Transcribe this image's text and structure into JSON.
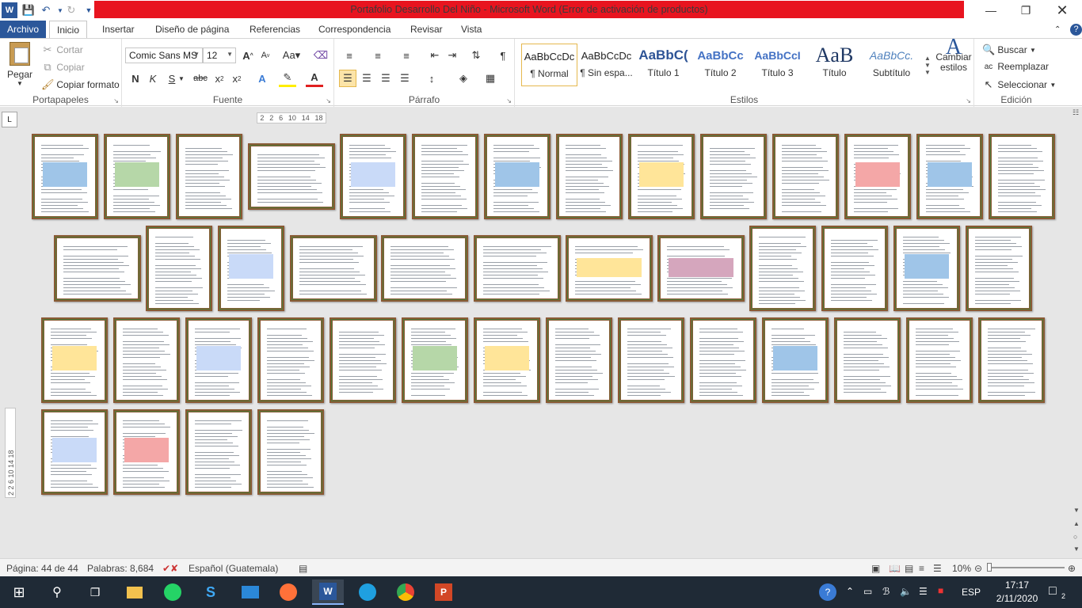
{
  "window": {
    "title": "Portafolio Desarrollo Del Niño  -  Microsoft Word (Error de activación de productos)",
    "controls": [
      "minimize",
      "restore",
      "close"
    ]
  },
  "tabs": [
    "Archivo",
    "Inicio",
    "Insertar",
    "Diseño de página",
    "Referencias",
    "Correspondencia",
    "Revisar",
    "Vista"
  ],
  "ribbon": {
    "clipboard": {
      "label": "Portapapeles",
      "paste": "Pegar",
      "cut": "Cortar",
      "copy": "Copiar",
      "format_painter": "Copiar formato"
    },
    "font": {
      "label": "Fuente",
      "family": "Comic Sans MS",
      "size": "12"
    },
    "paragraph": {
      "label": "Párrafo"
    },
    "styles": {
      "label": "Estilos",
      "items": [
        {
          "preview": "AaBbCcDc",
          "name": "¶ Normal"
        },
        {
          "preview": "AaBbCcDc",
          "name": "¶ Sin espa..."
        },
        {
          "preview": "AaBbC(",
          "name": "Título 1"
        },
        {
          "preview": "AaBbCc",
          "name": "Título 2"
        },
        {
          "preview": "AaBbCcI",
          "name": "Título 3"
        },
        {
          "preview": "AaB",
          "name": "Título"
        },
        {
          "preview": "AaBbCc.",
          "name": "Subtítulo"
        }
      ],
      "change": "Cambiar estilos"
    },
    "editing": {
      "label": "Edición",
      "find": "Buscar",
      "replace": "Reemplazar",
      "select": "Seleccionar"
    }
  },
  "ruler": {
    "marks": [
      "2",
      "2",
      "6",
      "10",
      "14",
      "18"
    ],
    "vmarks": "2 2 6 10 14 18"
  },
  "status": {
    "page": "Página: 44 de 44",
    "words": "Palabras: 8,684",
    "language": "Español (Guatemala)",
    "zoom": "10%"
  },
  "taskbar": {
    "language": "ESP",
    "time": "17:17",
    "date": "2/11/2020",
    "notifications": "2"
  },
  "colors": {
    "word_blue": "#2b579a",
    "title_bar_red": "#e8141f",
    "page_border": "#8a5a34",
    "taskbar": "#1f2a36"
  }
}
